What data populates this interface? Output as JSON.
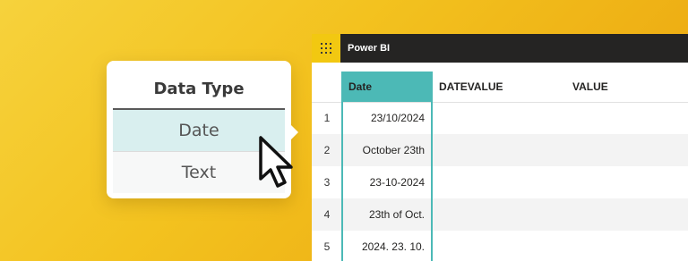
{
  "popup": {
    "title": "Data Type",
    "options": [
      "Date",
      "Text"
    ],
    "selected": "Date"
  },
  "window": {
    "app_name": "Power BI",
    "accent_color": "#f2c811",
    "columns": [
      "Date",
      "DATEVALUE",
      "VALUE"
    ],
    "rows": [
      {
        "num": "1",
        "date": "23/10/2024"
      },
      {
        "num": "2",
        "date": "October 23th"
      },
      {
        "num": "3",
        "date": "23-10-2024"
      },
      {
        "num": "4",
        "date": "23th of Oct."
      },
      {
        "num": "5",
        "date": "2024. 23. 10."
      }
    ]
  },
  "colors": {
    "background": "#f3c21f",
    "column_highlight": "#4cb9b6",
    "selected_option": "#d9efef",
    "titlebar": "#252423"
  },
  "icons": [
    "waffle-icon",
    "mouse-pointer-icon"
  ]
}
